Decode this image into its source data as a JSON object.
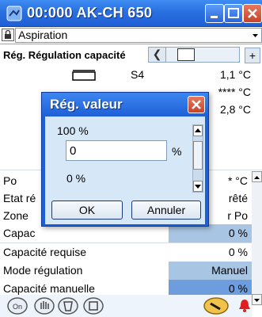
{
  "window": {
    "title": "00:000 AK-CH 650"
  },
  "selector": {
    "value": "Aspiration"
  },
  "regulation": {
    "label": "Rég. Régulation capacité"
  },
  "rows": {
    "s4": {
      "label": "S4",
      "value": "1,1 °C"
    },
    "r2": {
      "label": "",
      "value": "**** °C"
    },
    "r3": {
      "label": "",
      "value": "2,8 °C"
    },
    "po": {
      "label": "Po",
      "value": "* °C"
    },
    "etat": {
      "label": "Etat ré",
      "value": "rêté"
    },
    "zone": {
      "label": "Zone",
      "value": "r Po"
    },
    "capac": {
      "label": "Capac",
      "value": "0 %"
    },
    "capreq": {
      "label": "Capacité requise",
      "value": "0 %"
    },
    "mode": {
      "label": "Mode régulation",
      "value": "Manuel"
    },
    "capman": {
      "label": "Capacité manuelle",
      "value": "0 %"
    }
  },
  "dialog": {
    "title": "Rég. valeur",
    "max": "100 %",
    "min": "0 %",
    "input_value": "0",
    "unit": "%",
    "ok_label": "OK",
    "cancel_label": "Annuler"
  },
  "colors": {
    "titlebar": "#2a6fe0",
    "value_box": "#a9c5e4",
    "value_box_dark": "#6d9ddc",
    "dialog_body": "#d6e7f7"
  }
}
